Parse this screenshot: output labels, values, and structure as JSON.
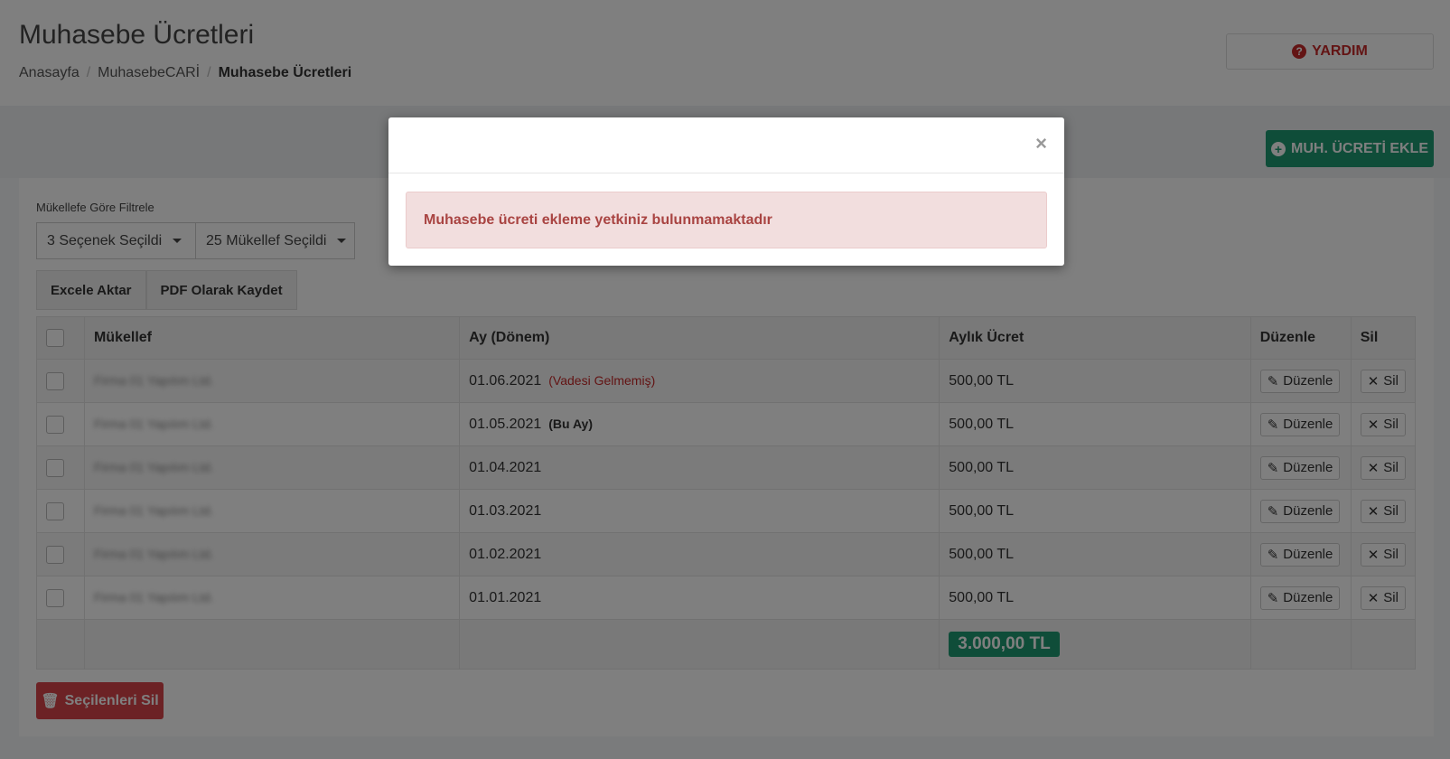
{
  "header": {
    "title": "Muhasebe Ücretleri",
    "help_label": "YARDIM",
    "breadcrumb": [
      "Anasayfa",
      "MuhasebeCARİ",
      "Muhasebe Ücretleri"
    ]
  },
  "toolbar": {
    "add_label": "MUH. ÜCRETİ EKLE"
  },
  "filter": {
    "label": "Mükellefe Göre Filtrele",
    "dropdown1": "3 Seçenek Seçildi",
    "dropdown2": "25 Mükellef Seçildi"
  },
  "export": {
    "excel_label": "Excele Aktar",
    "pdf_label": "PDF Olarak Kaydet"
  },
  "table": {
    "headers": [
      "Mükellef",
      "Ay (Dönem)",
      "Aylık Ücret",
      "Düzenle",
      "Sil"
    ],
    "edit_label": "Düzenle",
    "delete_label": "Sil",
    "rows": [
      {
        "client": "Firma 01 Yapılım Ltd.",
        "period": "01.06.2021",
        "note": "(Vadesi Gelmemiş)",
        "fee": "500,00 TL"
      },
      {
        "client": "Firma 01 Yapılım Ltd.",
        "period": "01.05.2021",
        "note": "(Bu Ay)",
        "fee": "500,00 TL"
      },
      {
        "client": "Firma 01 Yapılım Ltd.",
        "period": "01.04.2021",
        "note": "",
        "fee": "500,00 TL"
      },
      {
        "client": "Firma 01 Yapılım Ltd.",
        "period": "01.03.2021",
        "note": "",
        "fee": "500,00 TL"
      },
      {
        "client": "Firma 01 Yapılım Ltd.",
        "period": "01.02.2021",
        "note": "",
        "fee": "500,00 TL"
      },
      {
        "client": "Firma 01 Yapılım Ltd.",
        "period": "01.01.2021",
        "note": "",
        "fee": "500,00 TL"
      }
    ],
    "total": "3.000,00 TL"
  },
  "bulk": {
    "delete_selected_label": "Seçilenleri Sil"
  },
  "modal": {
    "close_symbol": "×",
    "message": "Muhasebe ücreti ekleme yetkiniz bulunmamaktadır"
  },
  "colors": {
    "accent_green": "#1e9b72",
    "danger_red": "#d9444b",
    "alert_bg": "#f2dede"
  }
}
